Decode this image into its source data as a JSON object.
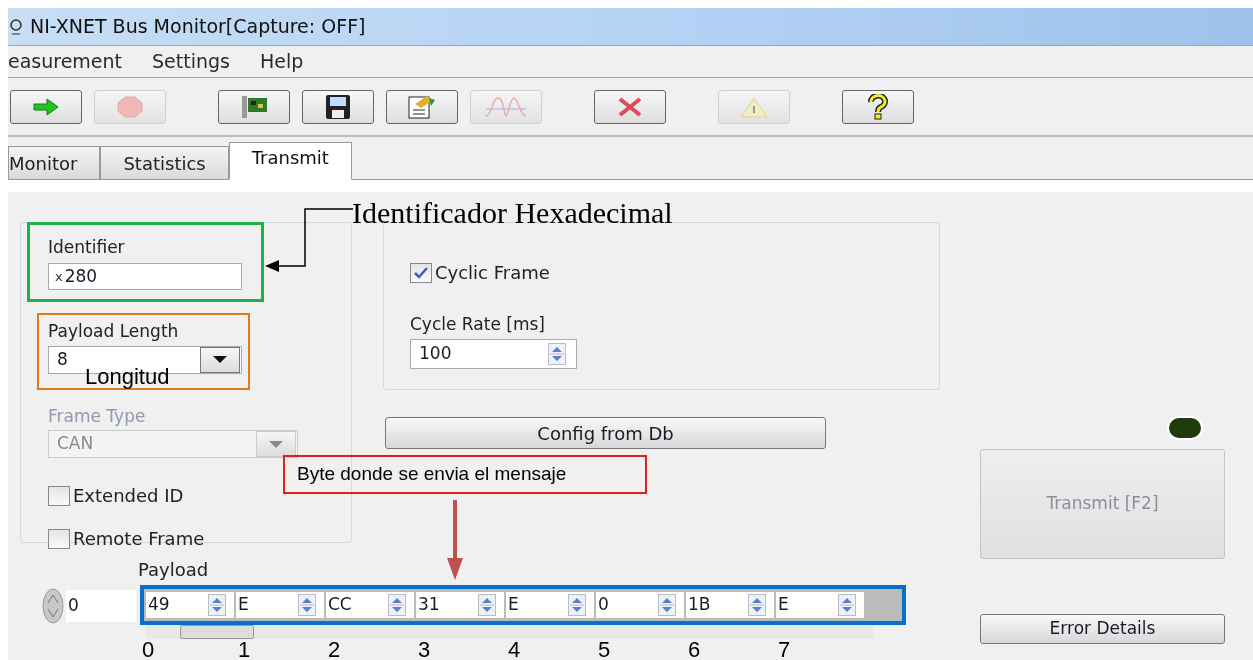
{
  "window": {
    "title": "NI-XNET Bus Monitor[Capture: OFF]"
  },
  "menu": [
    "easurement",
    "Settings",
    "Help"
  ],
  "toolbar": [
    [
      {
        "kind": "start",
        "disabled": false
      },
      {
        "kind": "stop",
        "disabled": true
      }
    ],
    [
      {
        "kind": "hardware",
        "disabled": false
      },
      {
        "kind": "save",
        "disabled": false
      },
      {
        "kind": "properties",
        "disabled": false
      },
      {
        "kind": "signal",
        "disabled": true
      }
    ],
    [
      {
        "kind": "clear",
        "disabled": false
      }
    ],
    [
      {
        "kind": "warning",
        "disabled": true
      }
    ],
    [
      {
        "kind": "help",
        "disabled": false
      }
    ]
  ],
  "tabs": [
    {
      "label": "Monitor",
      "selected": false
    },
    {
      "label": "Statistics",
      "selected": false
    },
    {
      "label": "Transmit",
      "selected": true
    }
  ],
  "frame": {
    "identifier": {
      "label": "Identifier",
      "radix": "x",
      "value": "280"
    },
    "payload_length": {
      "label": "Payload Length",
      "value": "8"
    },
    "frame_type": {
      "label": "Frame Type",
      "value": "CAN",
      "disabled": true
    },
    "checkboxes": [
      {
        "label": "Extended ID",
        "checked": false
      },
      {
        "label": "Remote Frame",
        "checked": false
      }
    ]
  },
  "cyclic": {
    "label": "Cyclic Frame",
    "checked": true
  },
  "cycle_rate": {
    "label": "Cycle Rate [ms]",
    "value": "100"
  },
  "config_button": "Config from Db",
  "led": {
    "on": false
  },
  "transmit_button": {
    "label": "Transmit [F2]",
    "disabled": true
  },
  "error_button": "Error Details",
  "payload": {
    "label": "Payload",
    "index": "0",
    "bytes": [
      "49",
      "E",
      "CC",
      "31",
      "E",
      "0",
      "1B",
      "E"
    ]
  },
  "annotations": {
    "identifier_note": "Identificador Hexadecimal",
    "length_note": "Longitud",
    "byte_note": "Byte donde se envia el mensaje",
    "byte_indices": [
      "0",
      "1",
      "2",
      "3",
      "4",
      "5",
      "6",
      "7"
    ]
  }
}
